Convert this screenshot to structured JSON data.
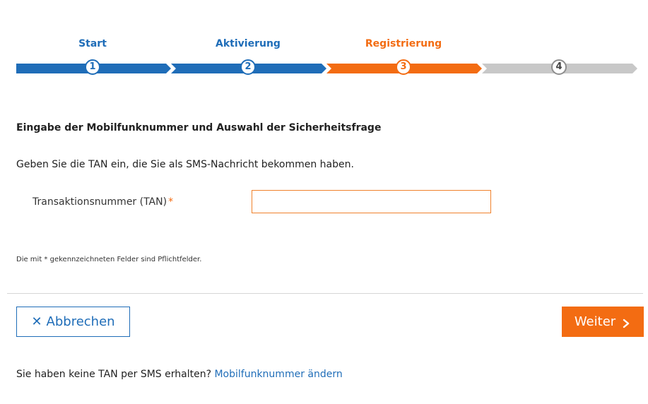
{
  "stepper": {
    "steps": [
      {
        "label": "Start",
        "number": "1",
        "state": "done"
      },
      {
        "label": "Aktivierung",
        "number": "2",
        "state": "done"
      },
      {
        "label": "Registrierung",
        "number": "3",
        "state": "active"
      },
      {
        "label": "",
        "number": "4",
        "state": "todo"
      }
    ],
    "colors": {
      "done": "#1f6db8",
      "active": "#f36c12",
      "todo": "#c8c8c8"
    }
  },
  "form": {
    "section_title": "Eingabe der Mobilfunknummer und Auswahl der Sicherheitsfrage",
    "instruction": "Geben Sie die TAN ein, die Sie als SMS-Nachricht bekommen haben.",
    "tan_label": "Transaktionsnummer (TAN)",
    "required_marker": "*",
    "tan_value": "",
    "required_note": "Die mit * gekennzeichneten Felder sind Pflichtfelder."
  },
  "actions": {
    "cancel_icon": "close-icon",
    "cancel_glyph": "✕",
    "cancel_label": "Abbrechen",
    "next_label": "Weiter",
    "next_icon": "chevron-right-icon"
  },
  "footer": {
    "question": "Sie haben keine TAN per SMS erhalten?",
    "link_label": "Mobilfunknummer ändern"
  }
}
